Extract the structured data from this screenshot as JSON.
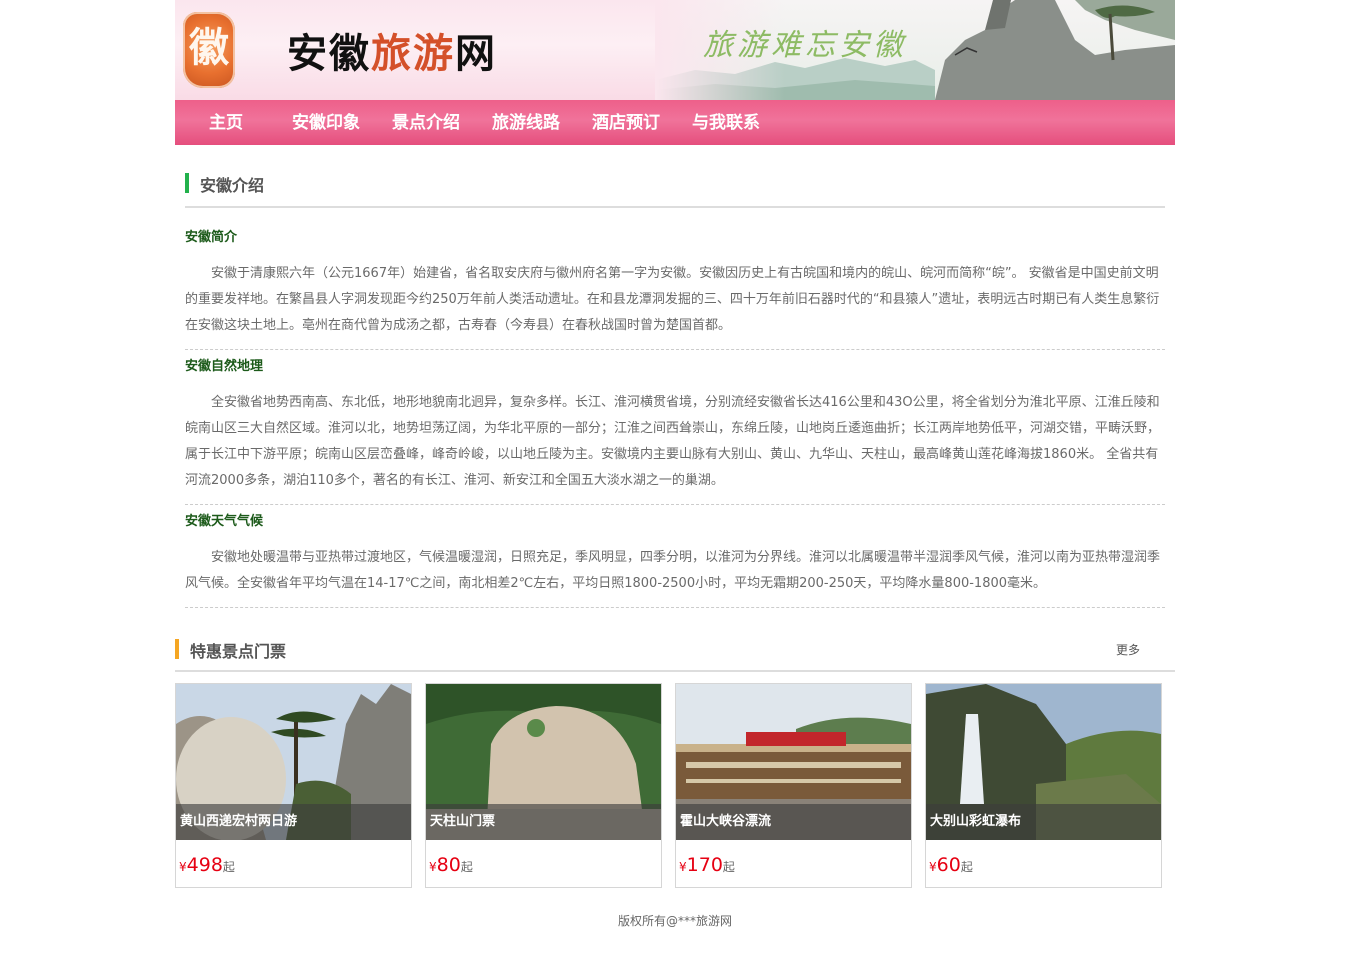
{
  "header": {
    "logo_glyph": "徽",
    "title_part1": "安徽",
    "title_part2": "旅游",
    "title_part3": "网",
    "slogan": "旅游难忘安徽"
  },
  "nav": {
    "items": [
      "主页",
      "安徽印象",
      "景点介绍",
      "旅游线路",
      "酒店预订",
      "与我联系"
    ]
  },
  "intro": {
    "title": "安徽介绍",
    "sections": [
      {
        "heading": "安徽简介",
        "text": "安徽于清康熙六年（公元1667年）始建省，省名取安庆府与徽州府名第一字为安徽。安徽因历史上有古皖国和境内的皖山、皖河而简称“皖”。 安徽省是中国史前文明的重要发祥地。在繁昌县人字洞发现距今约250万年前人类活动遗址。在和县龙潭洞发掘的三、四十万年前旧石器时代的“和县猿人”遗址，表明远古时期已有人类生息繁衍在安徽这块土地上。亳州在商代曾为成汤之都，古寿春（今寿县）在春秋战国时曾为楚国首都。"
      },
      {
        "heading": "安徽自然地理",
        "text": "全安徽省地势西南高、东北低，地形地貌南北迥异，复杂多样。长江、淮河横贯省境，分别流经安徽省长达416公里和43O公里，将全省划分为淮北平原、江淮丘陵和皖南山区三大自然区域。淮河以北，地势坦荡辽阔，为华北平原的一部分；江淮之间西耸崇山，东绵丘陵，山地岗丘逶迤曲折；长江两岸地势低平，河湖交错，平畴沃野，属于长江中下游平原；皖南山区层峦叠峰，峰奇岭峻，以山地丘陵为主。安徽境内主要山脉有大别山、黄山、九华山、天柱山，最高峰黄山莲花峰海拔1860米。 全省共有河流2000多条，湖泊110多个，著名的有长江、淮河、新安江和全国五大淡水湖之一的巢湖。"
      },
      {
        "heading": "安徽天气气候",
        "text": "安徽地处暖温带与亚热带过渡地区，气候温暖湿润，日照充足，季风明显，四季分明，以淮河为分界线。淮河以北属暖温带半湿润季风气候，淮河以南为亚热带湿润季风气候。全安徽省年平均气温在14-17℃之间，南北相差2℃左右，平均日照1800-2500小时，平均无霜期200-250天，平均降水量800-1800毫米。"
      }
    ]
  },
  "tickets": {
    "title": "特惠景点门票",
    "more": "更多",
    "currency": "¥",
    "suffix": "起",
    "items": [
      {
        "name": "黄山西递宏村两日游",
        "price": "498"
      },
      {
        "name": "天柱山门票",
        "price": "80"
      },
      {
        "name": "霍山大峡谷漂流",
        "price": "170"
      },
      {
        "name": "大别山彩虹瀑布",
        "price": "60"
      }
    ]
  },
  "footer": {
    "text": "版权所有@***旅游网"
  },
  "colors": {
    "nav_pink": "#ee5f8a",
    "intro_bar": "#22b14c",
    "tickets_bar": "#f5a623",
    "price_red": "#e60012"
  }
}
